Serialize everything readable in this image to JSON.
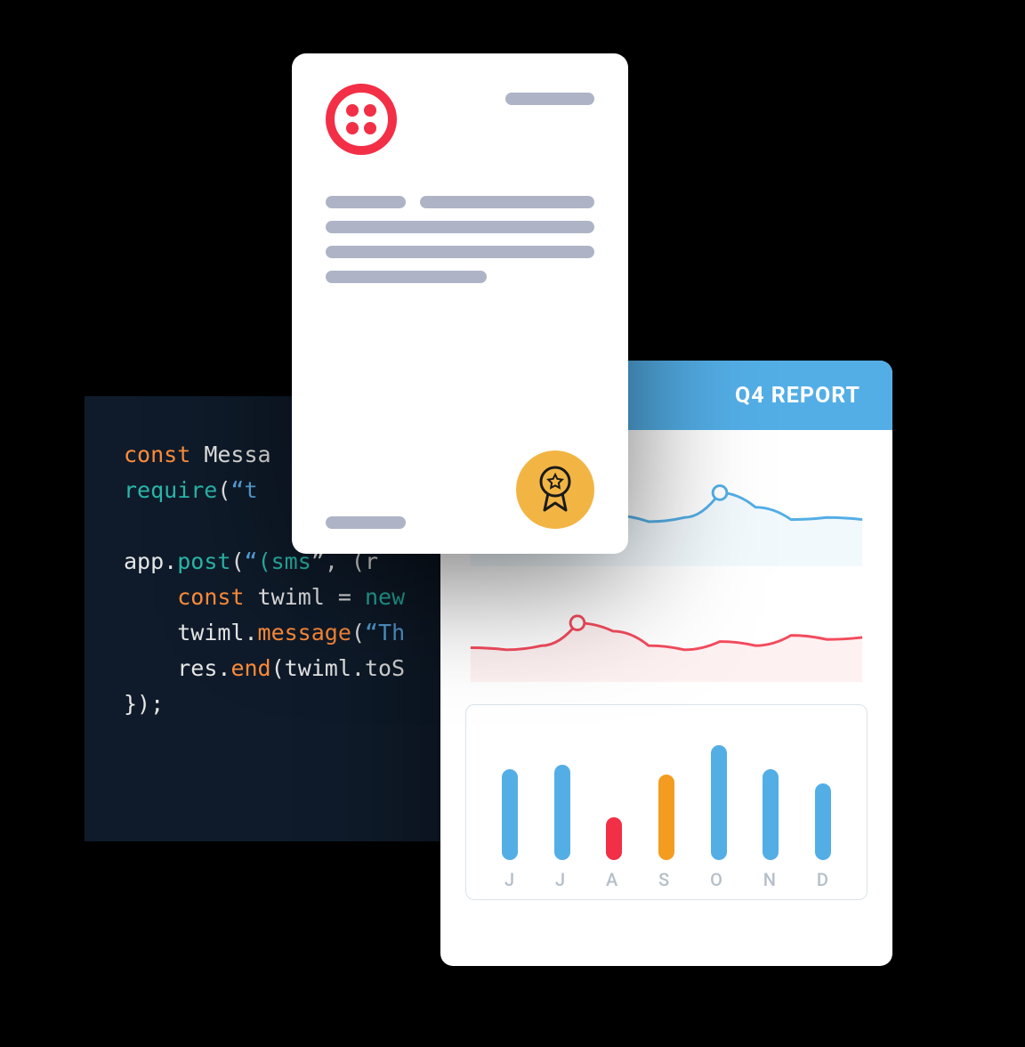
{
  "code": {
    "line1_kw": "const",
    "line1_cls": "Messa",
    "line2_fn": "require",
    "line2_paren": "(",
    "line2_quote": "“",
    "line2_str": "t",
    "line3_app": "app.",
    "line3_post": "post",
    "line3_sms": "(sms",
    "line3_rest": "”, (r",
    "line4_kw": "const",
    "line4_id": "twiml",
    "line4_eq": " = ",
    "line4_new": "new",
    "line5_id": "twiml.",
    "line5_method": "message",
    "line5_paren": "(",
    "line5_quote": "“",
    "line5_str": "Th",
    "line6_res": "res.",
    "line6_end": "end",
    "line6_rest": "(twiml.toS",
    "line7": "});"
  },
  "report": {
    "title": "Q4 REPORT"
  },
  "chart_data": [
    {
      "type": "line",
      "series": [
        {
          "name": "blue",
          "color": "#53aee6",
          "values": [
            25,
            30,
            40,
            48,
            44,
            38,
            42,
            66,
            52,
            40,
            42,
            40
          ],
          "marker_index": 7
        }
      ],
      "ylim": [
        0,
        100
      ]
    },
    {
      "type": "line",
      "series": [
        {
          "name": "red",
          "color": "#f44b5d",
          "values": [
            28,
            26,
            30,
            52,
            44,
            30,
            26,
            34,
            30,
            40,
            36,
            38
          ],
          "marker_index": 3
        }
      ],
      "ylim": [
        0,
        100
      ]
    },
    {
      "type": "bar",
      "categories": [
        "J",
        "J",
        "A",
        "S",
        "O",
        "N",
        "D"
      ],
      "values": [
        95,
        100,
        45,
        90,
        120,
        95,
        80
      ],
      "colors": [
        "#53aee6",
        "#53aee6",
        "#f22f46",
        "#f39c1f",
        "#53aee6",
        "#53aee6",
        "#53aee6"
      ],
      "ylim": [
        0,
        140
      ]
    }
  ]
}
